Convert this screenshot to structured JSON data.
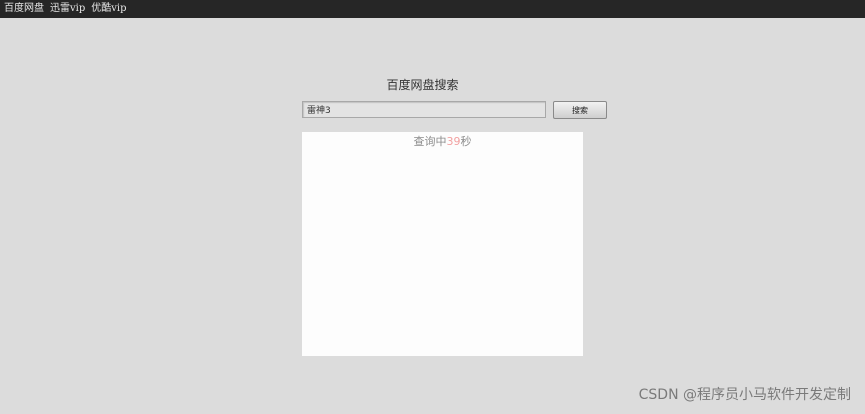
{
  "nav": {
    "items": [
      {
        "label": "百度网盘"
      },
      {
        "label": "迅雷vip"
      },
      {
        "label": "优酷vip"
      }
    ]
  },
  "page": {
    "title": "百度网盘搜索"
  },
  "search": {
    "value": "雷神3",
    "button_label": "搜索"
  },
  "status": {
    "prefix": "查询中",
    "count": "39",
    "suffix": "秒"
  },
  "watermark": {
    "text": "CSDN @程序员小马软件开发定制"
  },
  "colors": {
    "background": "#dcdcdc",
    "topbar": "#262626",
    "panel": "#fdfdfd",
    "count_accent": "#f2a0a0"
  }
}
